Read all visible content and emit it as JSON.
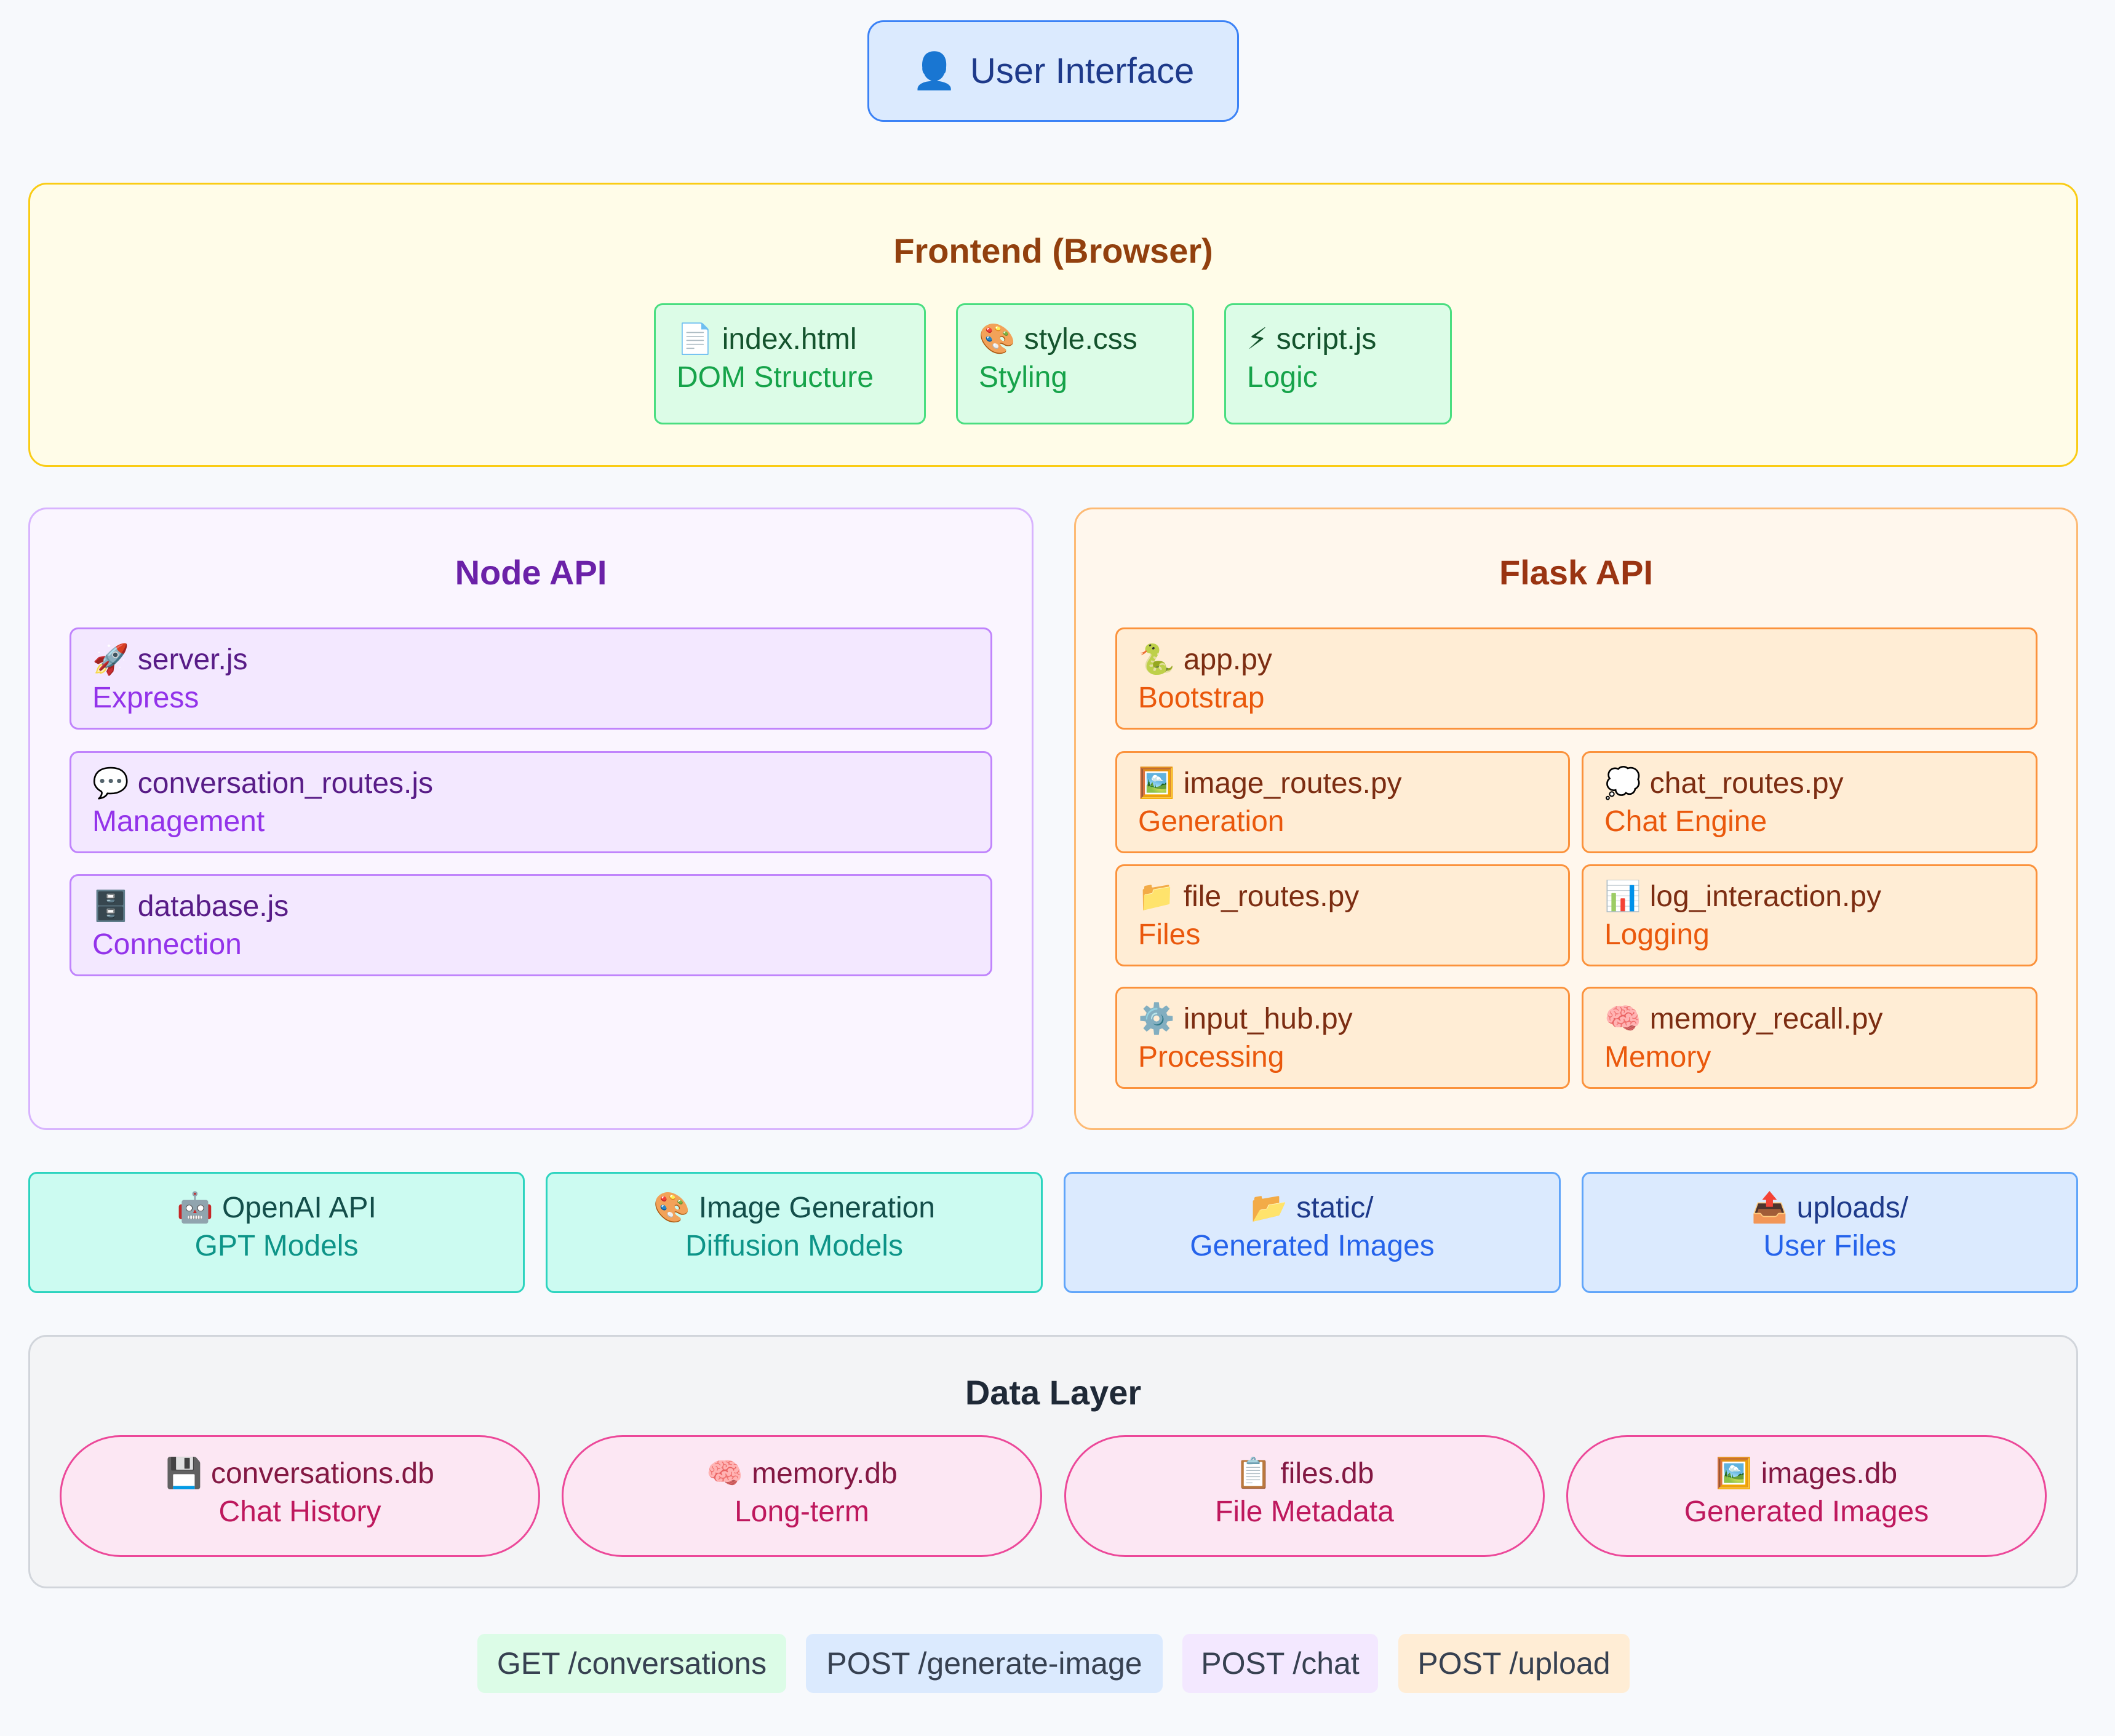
{
  "user_interface": {
    "icon": "user-silhouette-icon",
    "glyph": "👤",
    "label": "User Interface"
  },
  "frontend": {
    "title": "Frontend (Browser)",
    "cards": [
      {
        "glyph": "📄",
        "icon": "page-icon",
        "name": "index.html",
        "desc": "DOM Structure"
      },
      {
        "glyph": "🎨",
        "icon": "palette-icon",
        "name": "style.css",
        "desc": "Styling"
      },
      {
        "glyph": "⚡",
        "icon": "lightning-icon",
        "name": "script.js",
        "desc": "Logic"
      }
    ]
  },
  "node_api": {
    "title": "Node API",
    "cards": [
      {
        "glyph": "🚀",
        "icon": "rocket-icon",
        "name": "server.js",
        "desc": "Express"
      },
      {
        "glyph": "💬",
        "icon": "speech-bubble-icon",
        "name": "conversation_routes.js",
        "desc": "Management"
      },
      {
        "glyph": "🗄️",
        "icon": "file-cabinet-icon",
        "name": "database.js",
        "desc": "Connection"
      }
    ]
  },
  "flask_api": {
    "title": "Flask API",
    "cards": [
      {
        "glyph": "🐍",
        "icon": "snake-icon",
        "name": "app.py",
        "desc": "Bootstrap"
      },
      {
        "glyph": "🖼️",
        "icon": "framed-picture-icon",
        "name": "image_routes.py",
        "desc": "Generation"
      },
      {
        "glyph": "💭",
        "icon": "thought-bubble-icon",
        "name": "chat_routes.py",
        "desc": "Chat Engine"
      },
      {
        "glyph": "📁",
        "icon": "folder-icon",
        "name": "file_routes.py",
        "desc": "Files"
      },
      {
        "glyph": "📊",
        "icon": "bar-chart-icon",
        "name": "log_interaction.py",
        "desc": "Logging"
      },
      {
        "glyph": "⚙️",
        "icon": "gear-icon",
        "name": "input_hub.py",
        "desc": "Processing"
      },
      {
        "glyph": "🧠",
        "icon": "brain-icon",
        "name": "memory_recall.py",
        "desc": "Memory"
      }
    ]
  },
  "services": [
    {
      "glyph": "🤖",
      "icon": "robot-icon",
      "name": "OpenAI API",
      "desc": "GPT Models"
    },
    {
      "glyph": "🎨",
      "icon": "palette-icon",
      "name": "Image Generation",
      "desc": "Diffusion Models"
    },
    {
      "glyph": "📂",
      "icon": "open-folder-icon",
      "name": "static/",
      "desc": "Generated Images"
    },
    {
      "glyph": "📤",
      "icon": "outbox-tray-icon",
      "name": "uploads/",
      "desc": "User Files"
    }
  ],
  "data_layer": {
    "title": "Data Layer",
    "dbs": [
      {
        "glyph": "💾",
        "icon": "floppy-disk-icon",
        "name": "conversations.db",
        "desc": "Chat History"
      },
      {
        "glyph": "🧠",
        "icon": "brain-icon",
        "name": "memory.db",
        "desc": "Long-term"
      },
      {
        "glyph": "📋",
        "icon": "clipboard-icon",
        "name": "files.db",
        "desc": "File Metadata"
      },
      {
        "glyph": "🖼️",
        "icon": "framed-picture-icon",
        "name": "images.db",
        "desc": "Generated Images"
      }
    ]
  },
  "endpoints": [
    "GET /conversations",
    "POST /generate-image",
    "POST /chat",
    "POST /upload"
  ],
  "colors": {
    "frontend_border": "#facc15",
    "node_border": "#d8b4fe",
    "flask_border": "#fdba74",
    "db_border": "#ec4899",
    "ui_border": "#3b82f6"
  }
}
